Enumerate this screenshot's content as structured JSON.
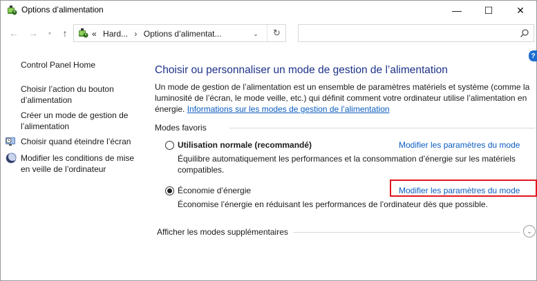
{
  "window": {
    "title": "Options d’alimentation",
    "minimize_glyph": "—",
    "maximize_glyph": "☐",
    "close_glyph": "✕"
  },
  "nav": {
    "back_glyph": "←",
    "forward_glyph": "→",
    "recent_glyph": "▾",
    "up_glyph": "↑",
    "breadcrumb": {
      "overflow": "«",
      "item1": "Hard...",
      "separator": "›",
      "item2": "Options d’alimentat...",
      "separator2": "›"
    },
    "dropdown_glyph": "⌄",
    "refresh_glyph": "↻",
    "search_placeholder": ""
  },
  "help": {
    "glyph": "?"
  },
  "sidebar": {
    "home": "Control Panel Home",
    "items": [
      {
        "label": "Choisir l’action du bouton d’alimentation",
        "icon": "none"
      },
      {
        "label": "Créer un mode de gestion de l’alimentation",
        "icon": "none"
      },
      {
        "label": "Choisir quand éteindre l’écran",
        "icon": "monitor-clock-icon"
      },
      {
        "label": "Modifier les conditions de mise en veille de l’ordinateur",
        "icon": "moon-icon"
      }
    ]
  },
  "main": {
    "title": "Choisir ou personnaliser un mode de gestion de l’alimentation",
    "description": "Un mode de gestion de l’alimentation est un ensemble de paramètres matériels et système (comme la luminosité de l’écran, le mode veille, etc.) qui définit comment votre ordinateur utilise l’alimentation en énergie.",
    "info_link": "Informations sur les modes de gestion de l’alimentation",
    "group_label": "Modes favoris",
    "plans": [
      {
        "name": "Utilisation normale (recommandé)",
        "selected": false,
        "link": "Modifier les paramètres du mode",
        "description": "Équilibre automatiquement les performances et la consommation d’énergie sur les matériels compatibles."
      },
      {
        "name": "Économie d’énergie",
        "selected": true,
        "link": "Modifier les paramètres du mode",
        "description": "Économise l’énergie en réduisant les performances de l’ordinateur dès que possible."
      }
    ],
    "extra_label": "Afficher les modes supplémentaires",
    "extra_glyph": "⌄"
  },
  "colors": {
    "title_blue": "#1e3287",
    "link_blue": "#0b5cbf",
    "highlight_red": "#e0141e"
  }
}
